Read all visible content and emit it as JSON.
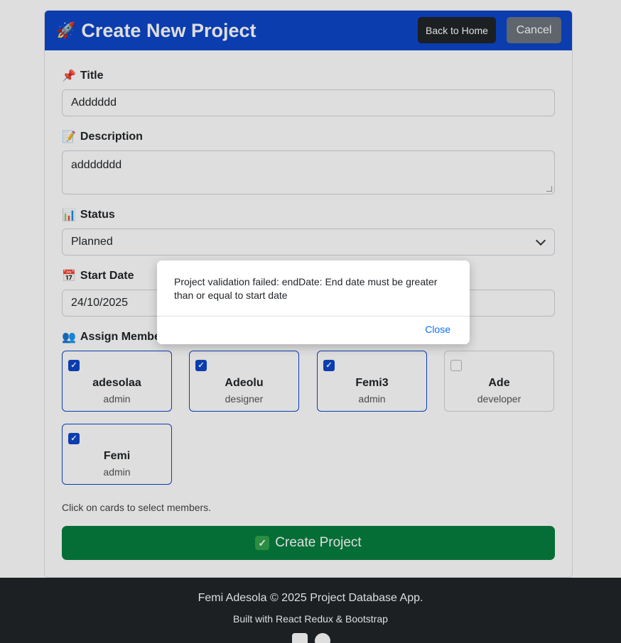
{
  "header": {
    "title": "Create New Project",
    "rocket": "🚀",
    "back_home_label": "Back to Home",
    "cancel_label": "Cancel"
  },
  "form": {
    "title_label": "Title",
    "title_icon": "📌",
    "title_value": "Adddddd",
    "description_label": "Description",
    "description_icon": "📝",
    "description_value": "addddddd",
    "status_label": "Status",
    "status_icon": "📊",
    "status_value": "Planned",
    "start_date_label": "Start Date",
    "start_date_icon": "📅",
    "start_date_value": "24/10/2025",
    "assign_label": "Assign Members",
    "assign_icon": "👥"
  },
  "members": [
    {
      "name": "adesolaa",
      "role": "admin",
      "selected": true
    },
    {
      "name": "Adeolu",
      "role": "designer",
      "selected": true
    },
    {
      "name": "Femi3",
      "role": "admin",
      "selected": true
    },
    {
      "name": "Ade",
      "role": "developer",
      "selected": false
    },
    {
      "name": "Femi",
      "role": "admin",
      "selected": true
    }
  ],
  "hint": "Click on cards to select members.",
  "create_button": {
    "label": "Create Project",
    "icon": "✓"
  },
  "footer": {
    "line1": "Femi Adesola © 2025 Project Database App.",
    "line2": "Built with React Redux & Bootstrap"
  },
  "modal": {
    "message": "Project validation failed: endDate: End date must be greater than or equal to start date",
    "close_label": "Close"
  },
  "colors": {
    "primary": "#0d47c9",
    "success": "#067f3f",
    "dark": "#212529",
    "secondary": "#6c757d"
  }
}
